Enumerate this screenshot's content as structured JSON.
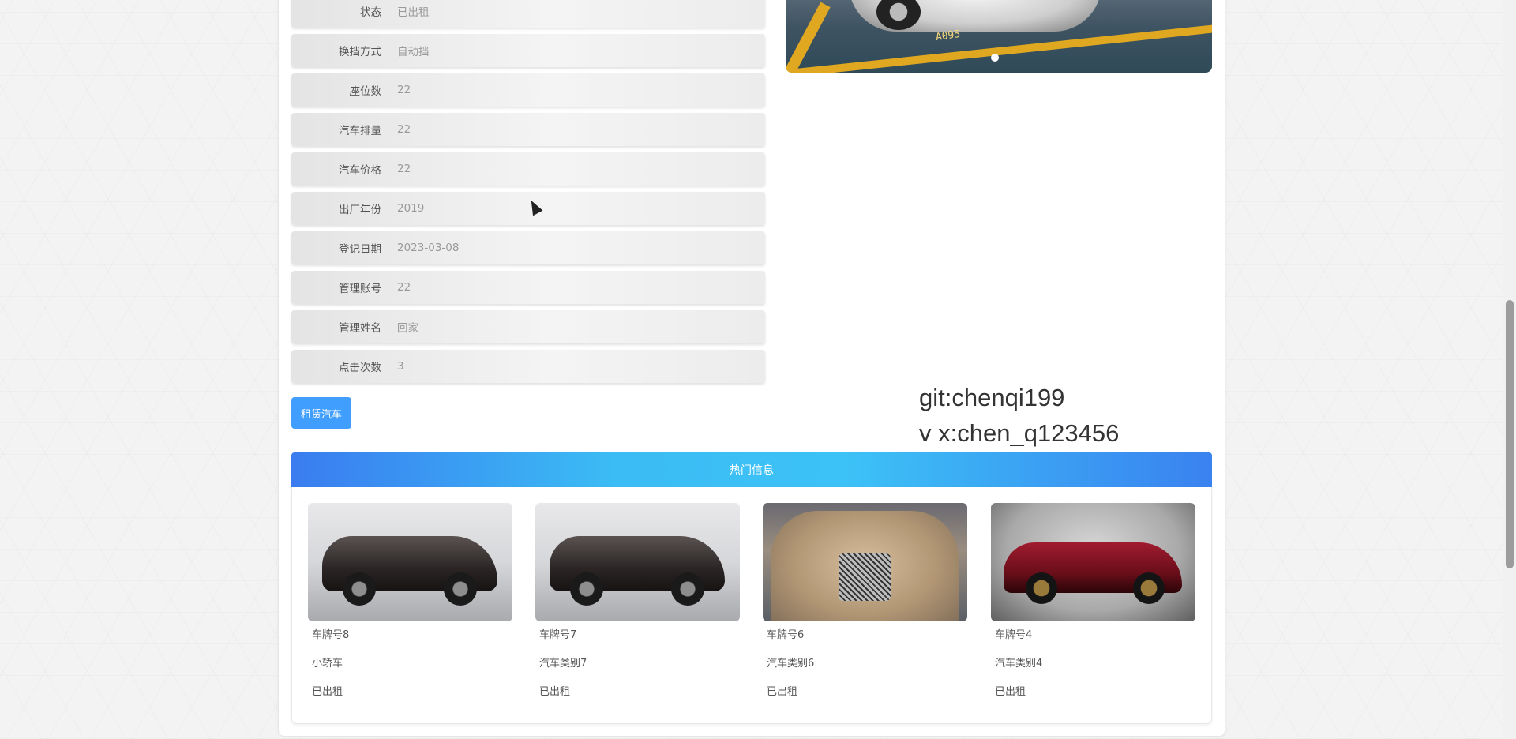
{
  "detail": {
    "fields": [
      {
        "label": "状态",
        "value": "已出租"
      },
      {
        "label": "换挡方式",
        "value": "自动挡"
      },
      {
        "label": "座位数",
        "value": "22"
      },
      {
        "label": "汽车排量",
        "value": "22"
      },
      {
        "label": "汽车价格",
        "value": "22"
      },
      {
        "label": "出厂年份",
        "value": "2019"
      },
      {
        "label": "登记日期",
        "value": "2023-03-08"
      },
      {
        "label": "管理账号",
        "value": "22"
      },
      {
        "label": "管理姓名",
        "value": "回家"
      },
      {
        "label": "点击次数",
        "value": "3"
      }
    ],
    "rent_button": "租赁汽车"
  },
  "carousel": {
    "plate_text": "A095",
    "active_dot": 1
  },
  "watermark": {
    "line1": "git:chenqi199",
    "line2": "v x:chen_q123456"
  },
  "hot": {
    "header": "热门信息",
    "cards": [
      {
        "plate": "车牌号8",
        "category": "小轿车",
        "status": "已出租",
        "image": "black-suv-showroom"
      },
      {
        "plate": "车牌号7",
        "category": "汽车类别7",
        "status": "已出租",
        "image": "black-suv-showroom"
      },
      {
        "plate": "车牌号6",
        "category": "汽车类别6",
        "status": "已出租",
        "image": "bentley-front"
      },
      {
        "plate": "车牌号4",
        "category": "汽车类别4",
        "status": "已出租",
        "image": "red-mclaren"
      }
    ]
  },
  "colors": {
    "primary": "#409eff",
    "header_gradient_start": "#3a7cf0",
    "header_gradient_mid": "#3cc2f6"
  }
}
